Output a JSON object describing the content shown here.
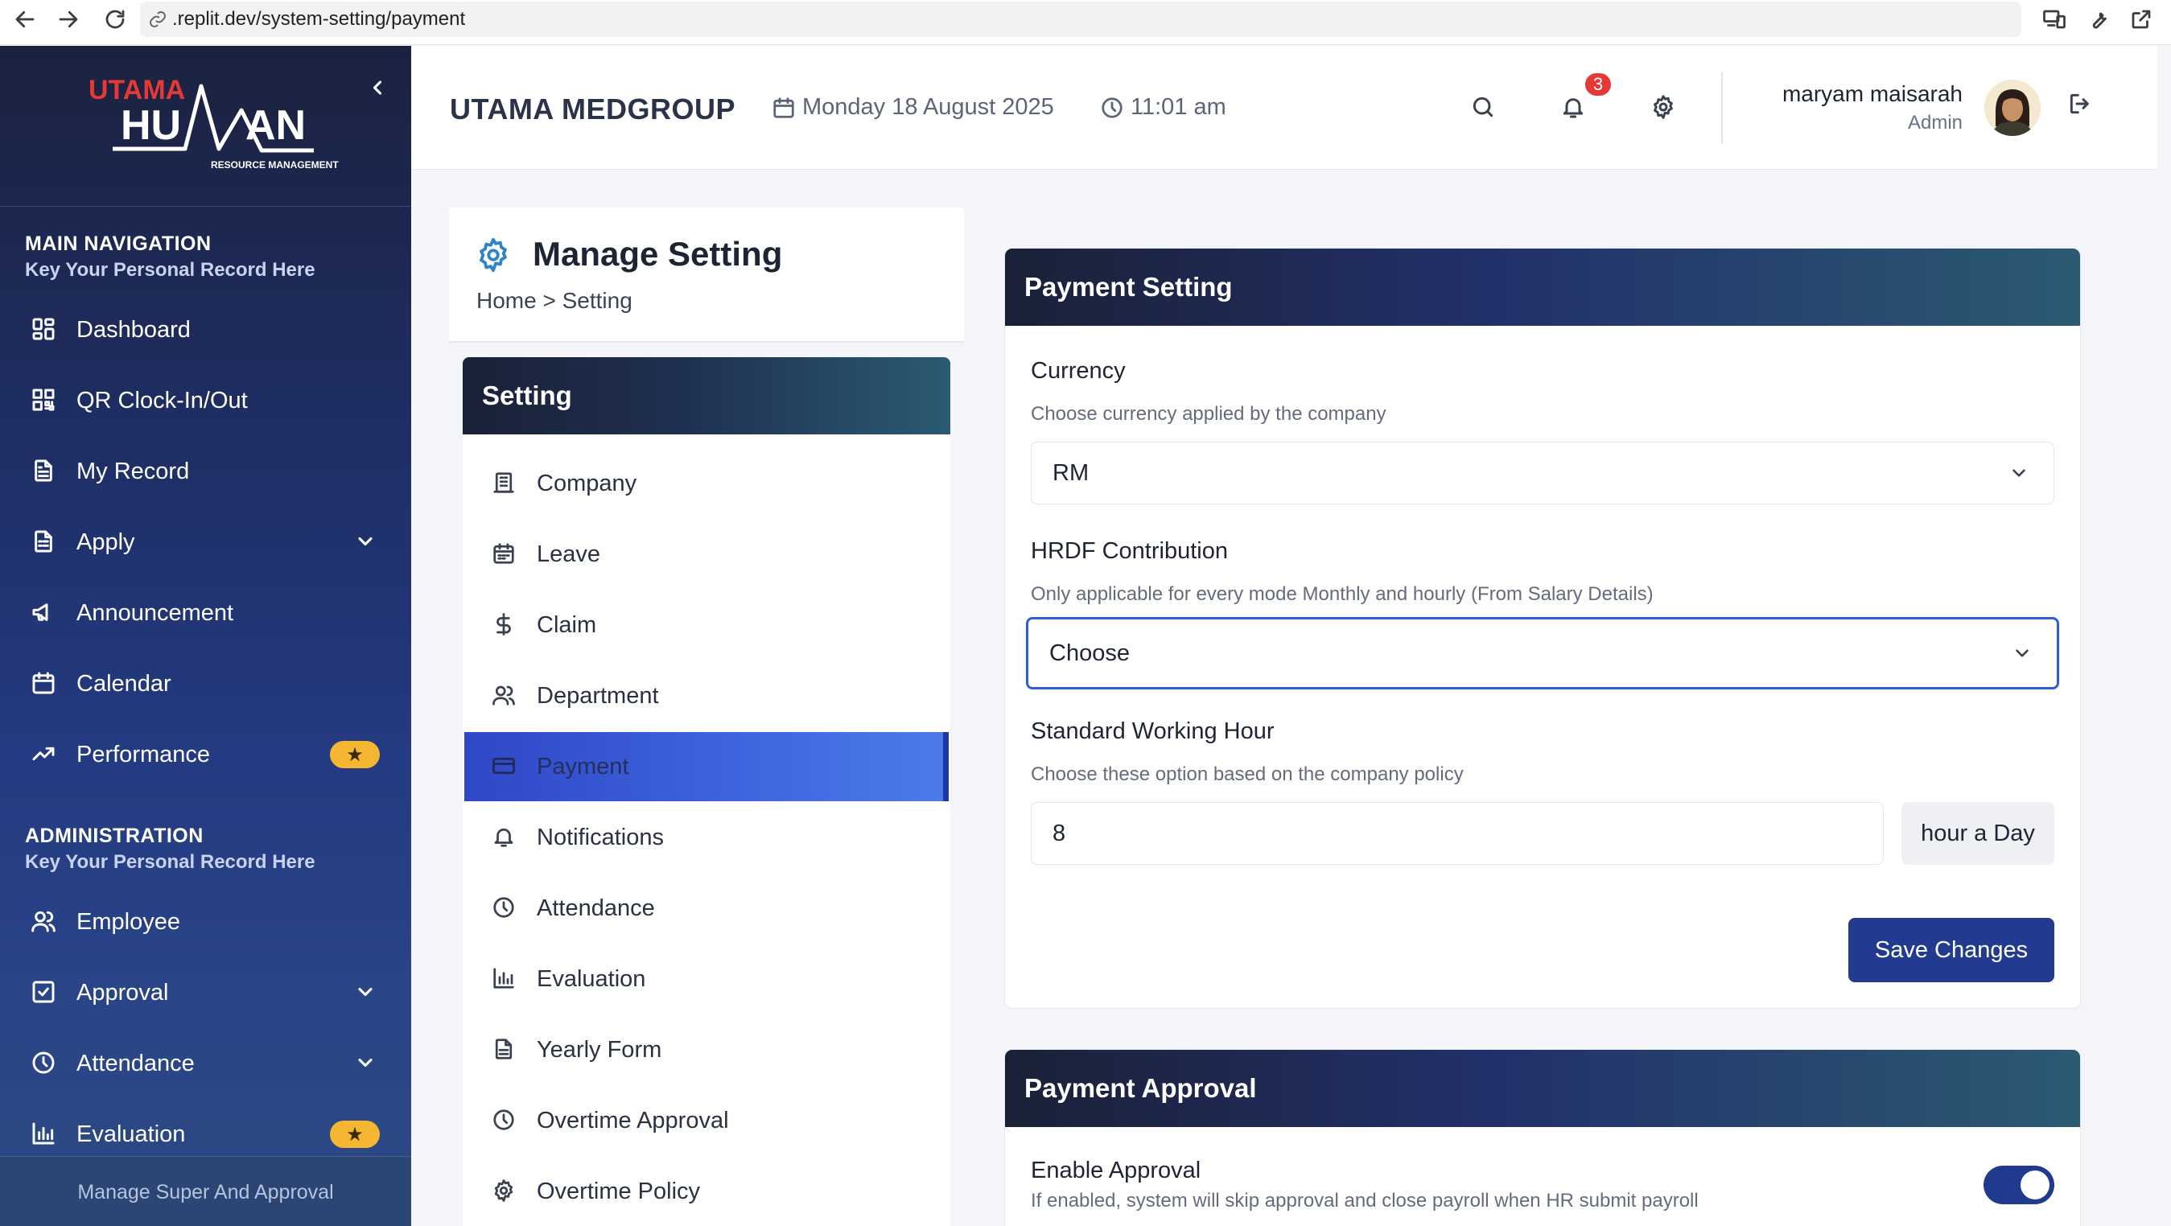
{
  "browser": {
    "url": ".replit.dev/system-setting/payment"
  },
  "logo": {
    "line1": "UTAMA",
    "line2a": "HU",
    "line2b": "AN",
    "line3": "RESOURCE MANAGEMENT"
  },
  "sidebar": {
    "main_title": "MAIN NAVIGATION",
    "main_sub": "Key Your Personal Record Here",
    "main_items": [
      {
        "label": "Dashboard"
      },
      {
        "label": "QR Clock-In/Out"
      },
      {
        "label": "My Record"
      },
      {
        "label": "Apply"
      },
      {
        "label": "Announcement"
      },
      {
        "label": "Calendar"
      },
      {
        "label": "Performance"
      }
    ],
    "admin_title": "ADMINISTRATION",
    "admin_sub": "Key Your Personal Record Here",
    "admin_items": [
      {
        "label": "Employee"
      },
      {
        "label": "Approval"
      },
      {
        "label": "Attendance"
      },
      {
        "label": "Evaluation"
      }
    ],
    "footer": "Manage Super And Approval",
    "badge_star": "★"
  },
  "header": {
    "company": "UTAMA MEDGROUP",
    "date": "Monday 18 August 2025",
    "time": "11:01 am",
    "notif_count": "3",
    "user_name": "maryam maisarah",
    "user_role": "Admin"
  },
  "manage": {
    "title": "Manage Setting",
    "breadcrumb": "Home > Setting"
  },
  "settings_menu": {
    "title": "Setting",
    "items": [
      {
        "label": "Company"
      },
      {
        "label": "Leave"
      },
      {
        "label": "Claim"
      },
      {
        "label": "Department"
      },
      {
        "label": "Payment"
      },
      {
        "label": "Notifications"
      },
      {
        "label": "Attendance"
      },
      {
        "label": "Evaluation"
      },
      {
        "label": "Yearly Form"
      },
      {
        "label": "Overtime Approval"
      },
      {
        "label": "Overtime Policy"
      }
    ]
  },
  "payment_setting": {
    "title": "Payment Setting",
    "currency_label": "Currency",
    "currency_help": "Choose currency applied by the company",
    "currency_value": "RM",
    "hrdf_label": "HRDF Contribution",
    "hrdf_help": "Only applicable for every mode Monthly and hourly (From Salary Details)",
    "hrdf_value": "Choose",
    "hour_label": "Standard Working Hour",
    "hour_help": "Choose these option based on the company policy",
    "hour_value": "8",
    "hour_addon": "hour a Day",
    "save_label": "Save Changes"
  },
  "payment_approval": {
    "title": "Payment Approval",
    "enable_label": "Enable Approval",
    "enable_help": "If enabled, system will skip approval and close payroll when HR submit payroll",
    "enabled": true
  },
  "colors": {
    "accent": "#223a8f",
    "active_item": "#3f66de",
    "badge": "#e53935",
    "star": "#f5b731"
  }
}
